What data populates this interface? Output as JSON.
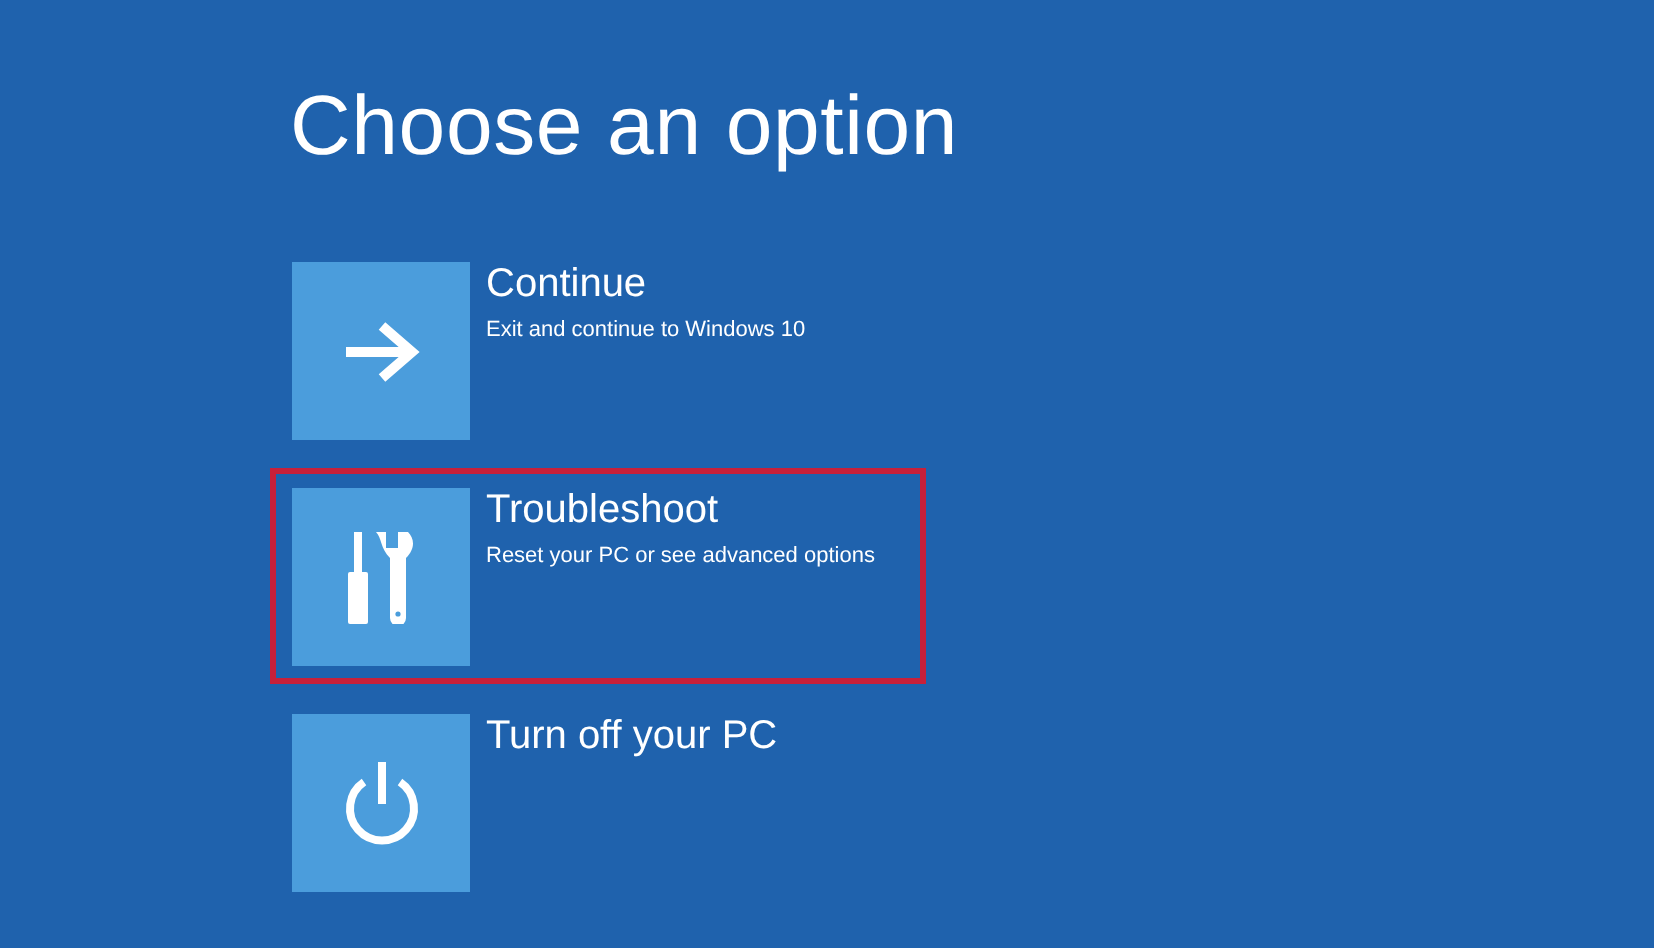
{
  "title": "Choose an option",
  "options": [
    {
      "kind": "arrow",
      "label": "Continue",
      "description": "Exit and continue to Windows 10",
      "selected": false
    },
    {
      "kind": "tools",
      "label": "Troubleshoot",
      "description": "Reset your PC or see advanced options",
      "selected": true
    },
    {
      "kind": "power",
      "label": "Turn off your PC",
      "selected": false
    }
  ]
}
